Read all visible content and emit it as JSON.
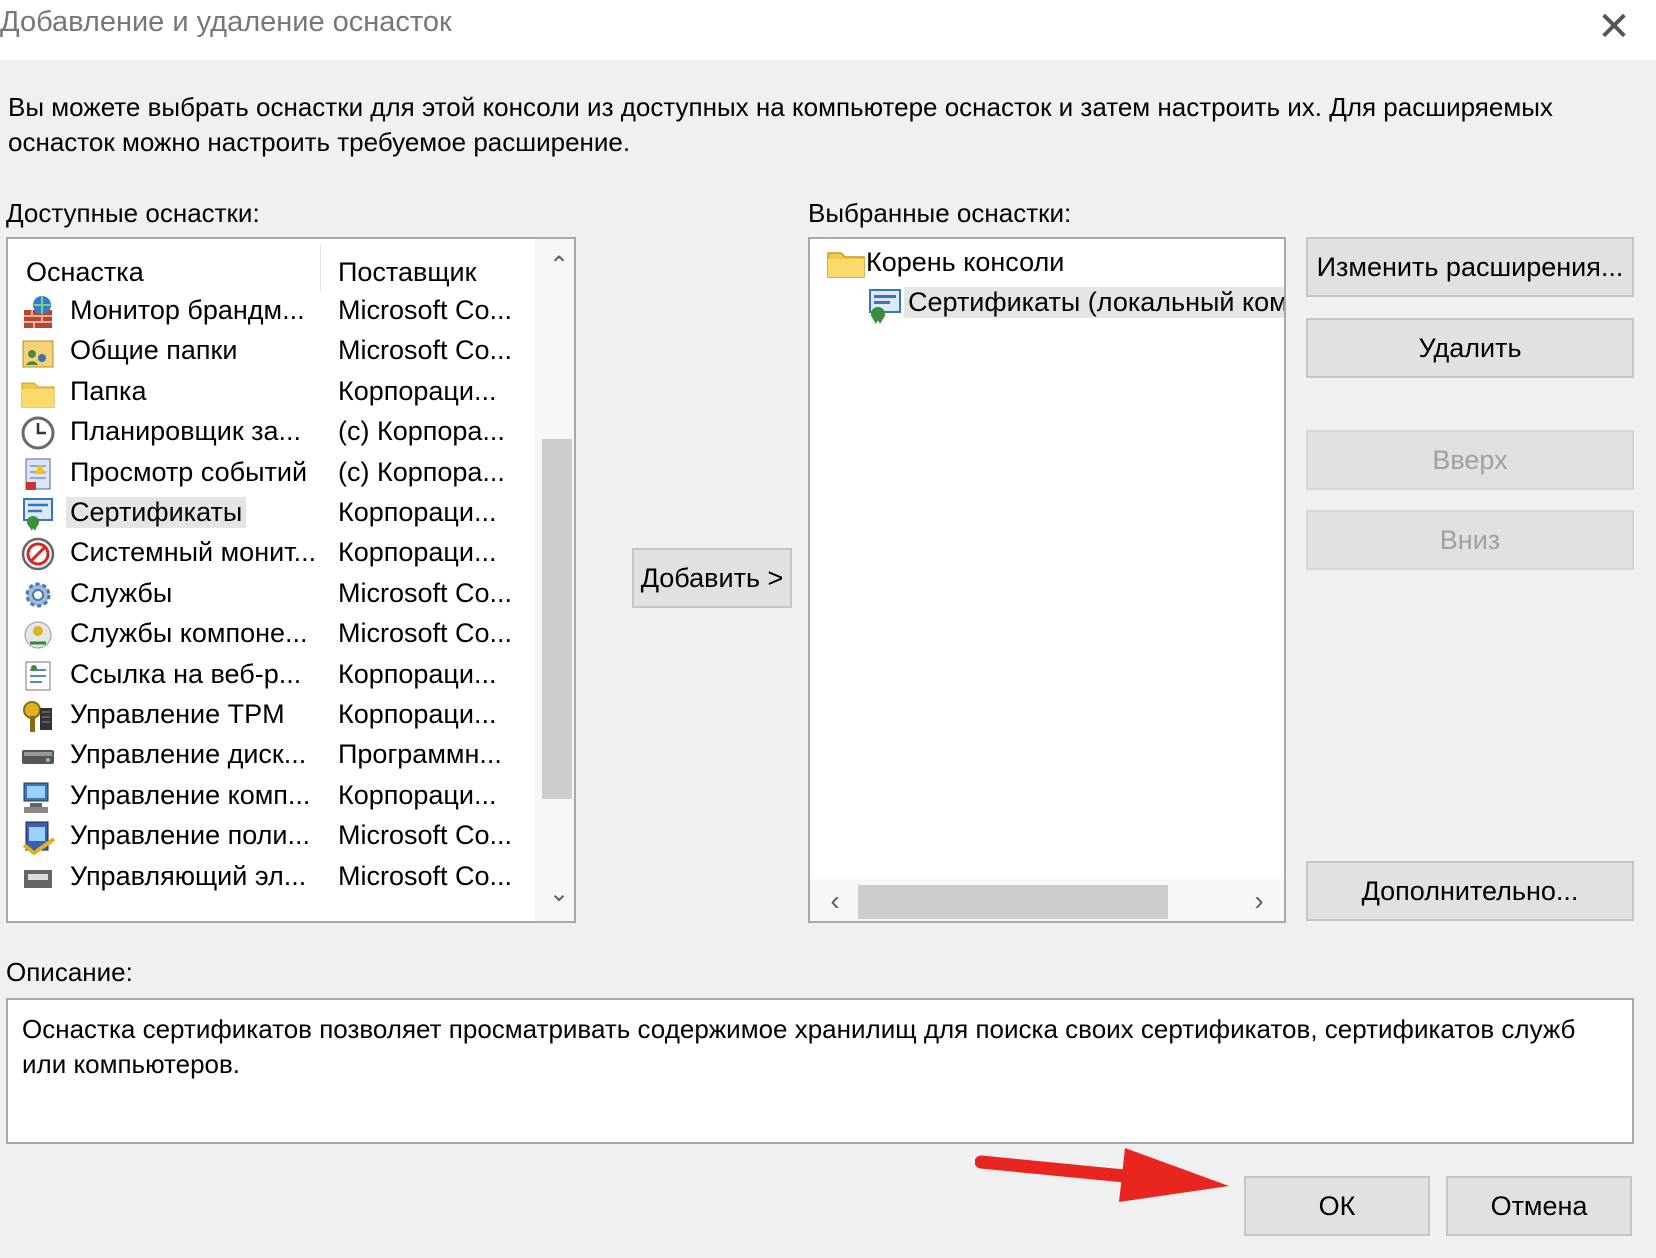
{
  "window": {
    "title": "Добавление и удаление оснасток",
    "close_glyph": "✕"
  },
  "intro": "Вы можете выбрать оснастки для этой консоли из доступных на компьютере оснасток и затем настроить их. Для расширяемых оснасток можно настроить требуемое расширение.",
  "available": {
    "label": "Доступные оснастки:",
    "columns": {
      "snapin": "Оснастка",
      "vendor": "Поставщик"
    },
    "items": [
      {
        "name": "Монитор брандм...",
        "vendor": "Microsoft Co...",
        "icon": "firewall-icon"
      },
      {
        "name": "Общие папки",
        "vendor": "Microsoft Co...",
        "icon": "shared-folders-icon"
      },
      {
        "name": "Папка",
        "vendor": "Корпораци...",
        "icon": "folder-icon"
      },
      {
        "name": "Планировщик за...",
        "vendor": "(c) Корпора...",
        "icon": "clock-icon"
      },
      {
        "name": "Просмотр событий",
        "vendor": "(c) Корпора...",
        "icon": "event-viewer-icon"
      },
      {
        "name": "Сертификаты",
        "vendor": "Корпораци...",
        "icon": "certificate-icon",
        "selected": true
      },
      {
        "name": "Системный монит...",
        "vendor": "Корпораци...",
        "icon": "system-monitor-icon"
      },
      {
        "name": "Службы",
        "vendor": "Microsoft Co...",
        "icon": "gear-icon"
      },
      {
        "name": "Службы компоне...",
        "vendor": "Microsoft Co...",
        "icon": "component-services-icon"
      },
      {
        "name": "Ссылка на веб-р...",
        "vendor": "Корпораци...",
        "icon": "web-link-icon"
      },
      {
        "name": "Управление TPM",
        "vendor": "Корпораци...",
        "icon": "tpm-key-icon"
      },
      {
        "name": "Управление диск...",
        "vendor": "Программн...",
        "icon": "disk-icon"
      },
      {
        "name": "Управление комп...",
        "vendor": "Корпораци...",
        "icon": "computer-management-icon"
      },
      {
        "name": "Управление поли...",
        "vendor": "Microsoft Co...",
        "icon": "policy-icon"
      },
      {
        "name": "Управляющий эл...",
        "vendor": "Microsoft Co...",
        "icon": "control-icon"
      }
    ]
  },
  "add_button": "Добавить >",
  "selected": {
    "label": "Выбранные оснастки:",
    "root": "Корень консоли",
    "child": "Сертификаты (локальный компьютер)"
  },
  "buttons": {
    "edit_extensions": "Изменить расширения...",
    "remove": "Удалить",
    "up": "Вверх",
    "down": "Вниз",
    "advanced": "Дополнительно...",
    "ok": "ОК",
    "cancel": "Отмена"
  },
  "description": {
    "label": "Описание:",
    "text": "Оснастка сертификатов позволяет просматривать содержимое хранилищ для поиска своих сертификатов, сертификатов служб или компьютеров."
  },
  "colors": {
    "annotation_arrow": "#e8261f",
    "selection": "#e5e5e5",
    "button_face": "#e1e1e1"
  }
}
